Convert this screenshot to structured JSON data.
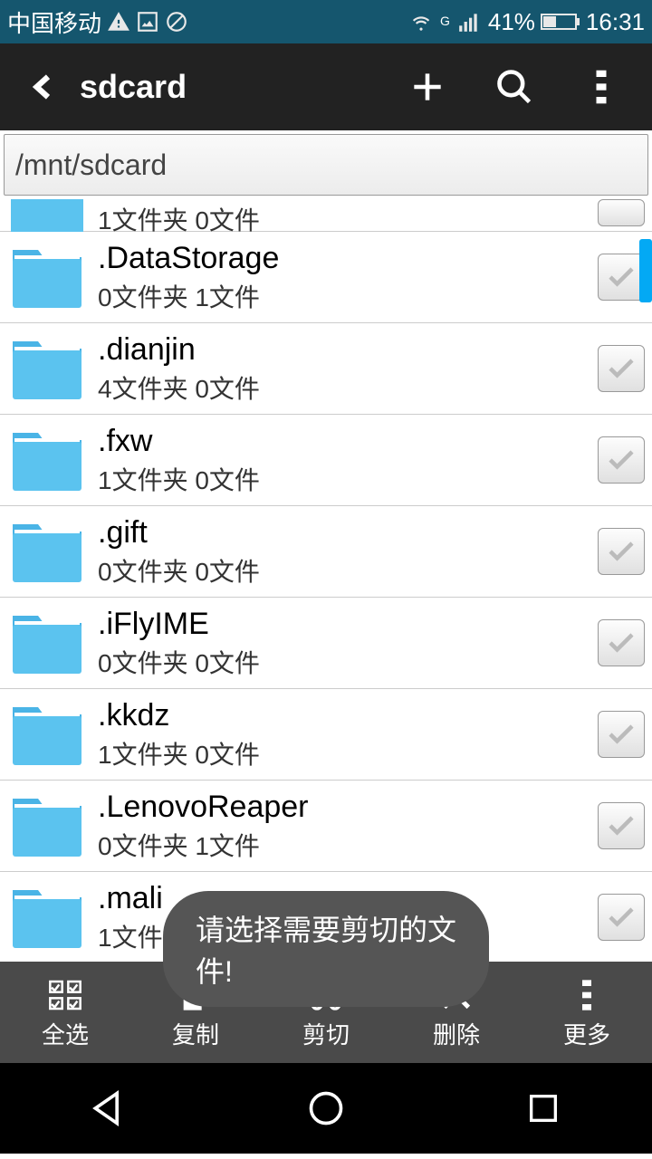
{
  "status": {
    "carrier": "中国移动",
    "battery": "41%",
    "time": "16:31",
    "network_g": "G"
  },
  "header": {
    "title": "sdcard"
  },
  "path": "/mnt/sdcard",
  "partial_row": {
    "sub": "1文件夹  0文件"
  },
  "rows": [
    {
      "name": ".DataStorage",
      "sub": "0文件夹  1文件"
    },
    {
      "name": ".dianjin",
      "sub": "4文件夹  0文件"
    },
    {
      "name": ".fxw",
      "sub": "1文件夹  0文件"
    },
    {
      "name": ".gift",
      "sub": "0文件夹  0文件"
    },
    {
      "name": ".iFlyIME",
      "sub": "0文件夹  0文件"
    },
    {
      "name": ".kkdz",
      "sub": "1文件夹  0文件"
    },
    {
      "name": ".LenovoReaper",
      "sub": "0文件夹  1文件"
    },
    {
      "name": ".mali    ",
      "sub": "1文件夹  0文件"
    }
  ],
  "toast": "请选择需要剪切的文件!",
  "bottom": {
    "select_all": "全选",
    "copy": "复制",
    "cut": "剪切",
    "delete": "删除",
    "more": "更多"
  }
}
